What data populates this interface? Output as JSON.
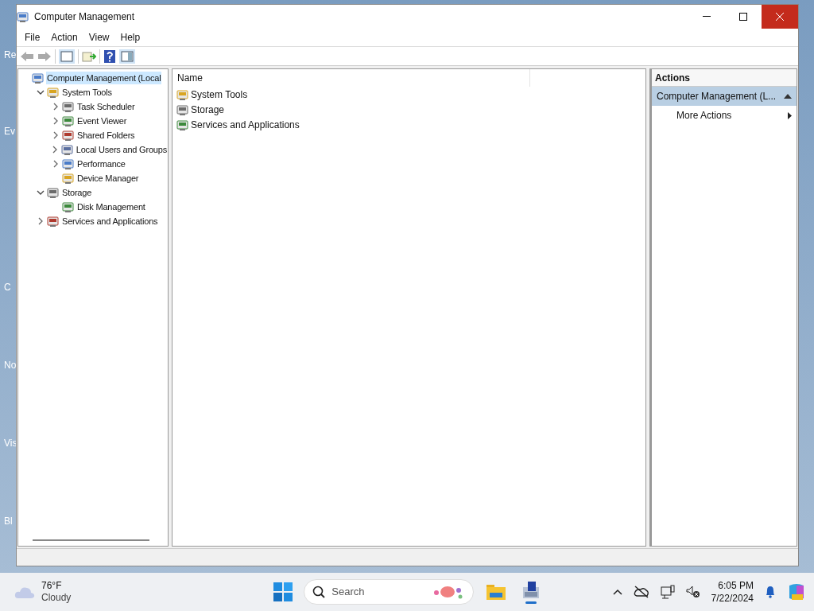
{
  "desktop_icons": [
    "Re",
    "Ev",
    "C",
    "No",
    "Vis",
    "Bl"
  ],
  "window": {
    "title": "Computer Management"
  },
  "menu": [
    "File",
    "Action",
    "View",
    "Help"
  ],
  "tree": [
    {
      "label": "Computer Management (Local",
      "selected": true,
      "children": [
        {
          "label": "System Tools",
          "selected": false,
          "expanded": true,
          "children": [
            {
              "label": "Task Scheduler",
              "selected": false,
              "expanded": false
            },
            {
              "label": "Event Viewer",
              "selected": false,
              "expanded": false
            },
            {
              "label": "Shared Folders",
              "selected": false,
              "expanded": false
            },
            {
              "label": "Local Users and Groups",
              "selected": false,
              "expanded": false
            },
            {
              "label": "Performance",
              "selected": false,
              "expanded": false
            },
            {
              "label": "Device Manager",
              "selected": false
            }
          ]
        },
        {
          "label": "Storage",
          "selected": false,
          "expanded": true,
          "children": [
            {
              "label": "Disk Management",
              "selected": false
            }
          ]
        },
        {
          "label": "Services and Applications",
          "selected": false,
          "expanded": false
        }
      ]
    }
  ],
  "list": {
    "columns": [
      "Name"
    ],
    "rows": [
      "System Tools",
      "Storage",
      "Services and Applications"
    ]
  },
  "actions": {
    "title": "Actions",
    "section": "Computer Management (L...",
    "items": [
      "More Actions"
    ]
  },
  "taskbar": {
    "temperature": "76°F",
    "weather": "Cloudy",
    "search_placeholder": "Search",
    "time": "6:05 PM",
    "date": "7/22/2024"
  }
}
